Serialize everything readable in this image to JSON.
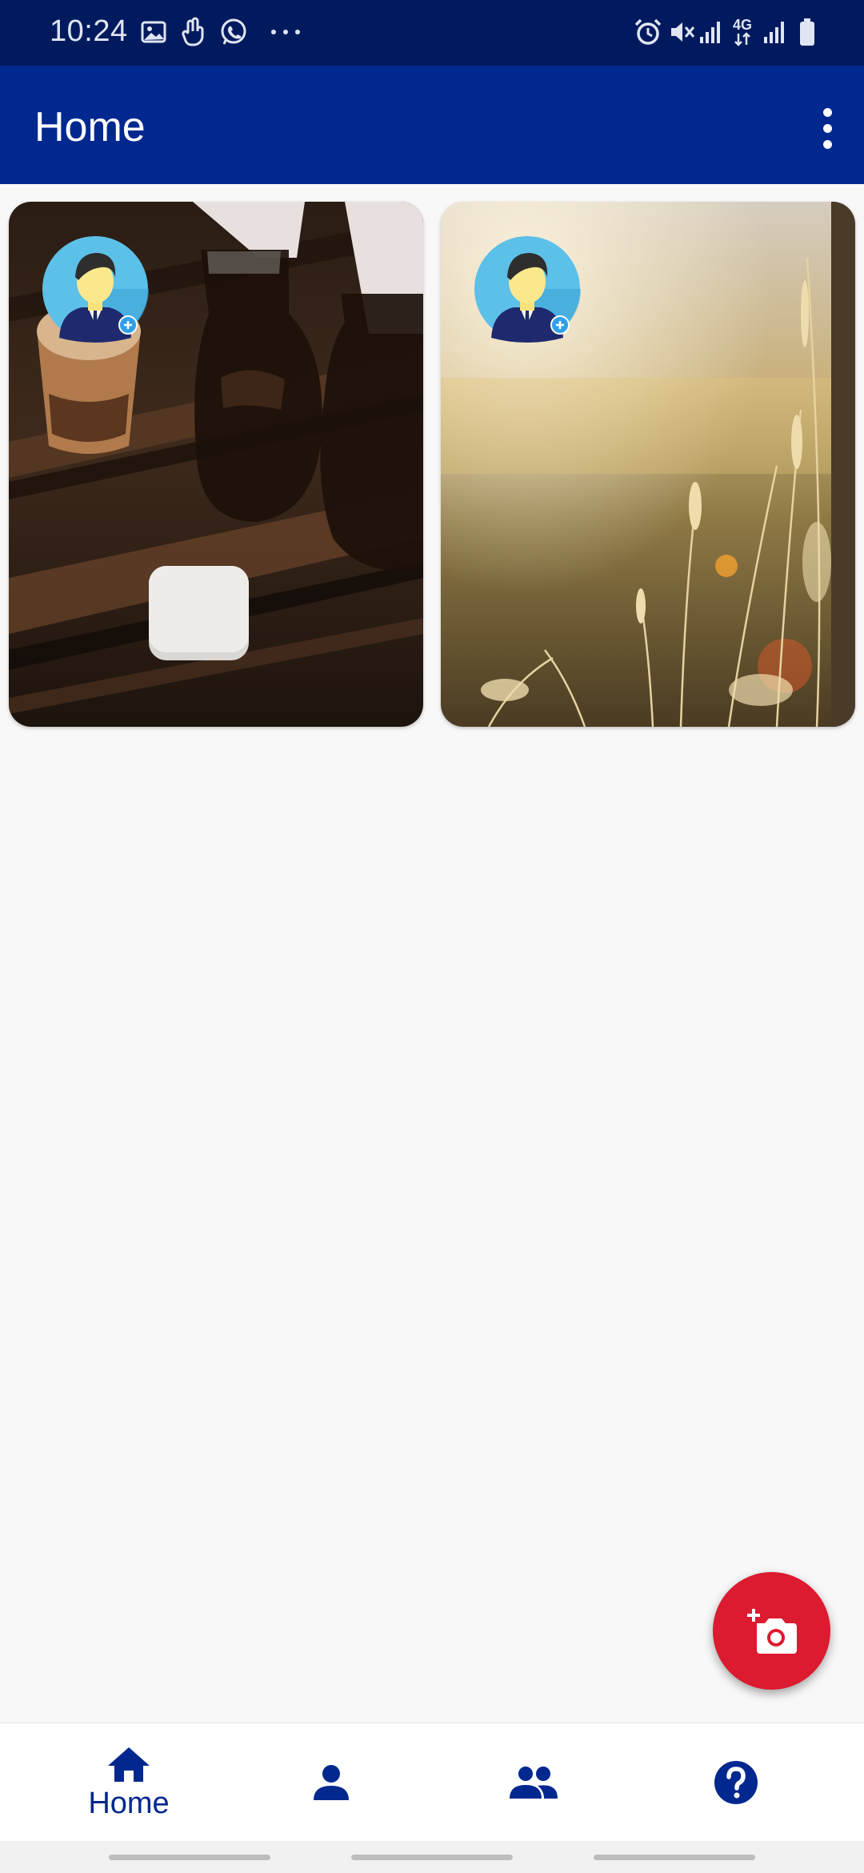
{
  "status_bar": {
    "time": "10:24",
    "left_icons": [
      "gallery-icon",
      "hand-touch-icon",
      "whatsapp-icon",
      "more-dots-icon"
    ],
    "right_icons": [
      "alarm-icon",
      "mute-icon",
      "signal-icon",
      "4g-data-icon",
      "signal-icon",
      "battery-icon"
    ],
    "network_label": "4G"
  },
  "app_bar": {
    "title": "Home",
    "menu_icon": "more-vert-icon"
  },
  "cards": [
    {
      "image": "coffee-carafes-photo",
      "avatar": "add-user-avatar-icon"
    },
    {
      "image": "sunlit-grass-photo",
      "avatar": "add-user-avatar-icon"
    }
  ],
  "fab": {
    "icon": "add-photo-camera-icon",
    "color": "#dc1a30"
  },
  "bottom_nav": {
    "items": [
      {
        "label": "Home",
        "icon": "home-icon",
        "active": true
      },
      {
        "label": "",
        "icon": "person-icon",
        "active": false
      },
      {
        "label": "",
        "icon": "group-icon",
        "active": false
      },
      {
        "label": "",
        "icon": "help-icon",
        "active": false
      }
    ]
  },
  "colors": {
    "status_bar": "#011a5e",
    "app_bar": "#01288f",
    "accent": "#dc1a30",
    "nav_icon": "#01288f",
    "background": "#f8f8f8"
  }
}
